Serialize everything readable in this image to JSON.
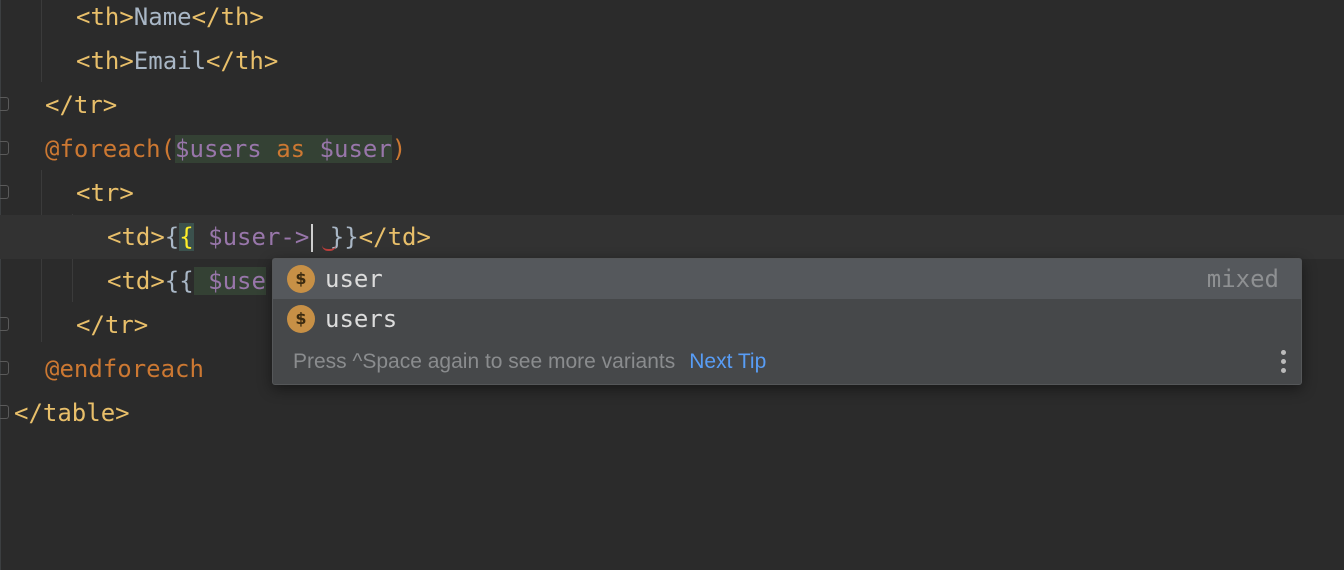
{
  "code_lines": {
    "l1": {
      "open": "<th>",
      "text": "Name",
      "close": "</th>"
    },
    "l2": {
      "open": "<th>",
      "text": "Email",
      "close": "</th>"
    },
    "l3": {
      "tag": "</tr>"
    },
    "l4": {
      "directive": "@foreach(",
      "var1": "$users",
      "kw": " as ",
      "var2": "$user",
      "close": ")"
    },
    "l5": {
      "tag": "<tr>"
    },
    "l6": {
      "open": "<td>",
      "brace1": "{",
      "brace2": "{",
      "space": " ",
      "var": "$user->",
      "end_braces": " }}",
      "close": "</td>"
    },
    "l7": {
      "open": "<td>",
      "braces": "{{",
      "space": " ",
      "var": "$use"
    },
    "l8": {
      "tag": "</tr>"
    },
    "l9": {
      "directive": "@endforeach"
    },
    "l10": {
      "tag": "</table>"
    }
  },
  "completion": {
    "items": [
      {
        "icon": "$",
        "label": "user",
        "type": "mixed"
      },
      {
        "icon": "$",
        "label": "users",
        "type": ""
      }
    ],
    "hint": "Press ^Space again to see more variants",
    "link": "Next Tip"
  },
  "colors": {
    "background": "#2b2b2b",
    "tag": "#e8bf6a",
    "directive": "#cc7832",
    "variable": "#9876aa",
    "link": "#589df6"
  }
}
